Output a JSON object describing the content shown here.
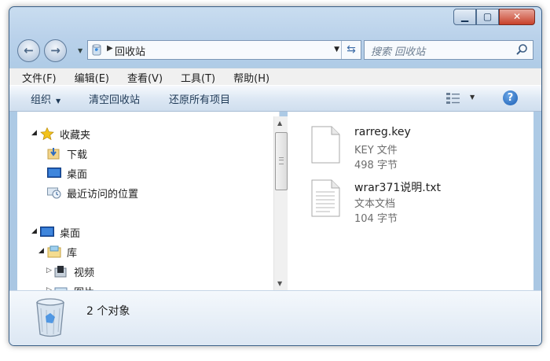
{
  "window": {
    "minimize_glyph": "▁",
    "maximize_glyph": "▢",
    "close_glyph": "✕"
  },
  "nav_buttons": {
    "back_glyph": "←",
    "forward_glyph": "→"
  },
  "address": {
    "path": "回收站",
    "icon": "recycle-bin-icon"
  },
  "search": {
    "placeholder": "搜索 回收站"
  },
  "menu": [
    "文件(F)",
    "编辑(E)",
    "查看(V)",
    "工具(T)",
    "帮助(H)"
  ],
  "toolbar": {
    "organize": "组织",
    "empty_bin": "清空回收站",
    "restore_all": "还原所有项目",
    "help_glyph": "?"
  },
  "nav_tree": {
    "favorites": {
      "label": "收藏夹",
      "items": [
        "下载",
        "桌面",
        "最近访问的位置"
      ]
    },
    "desktop": {
      "label": "桌面"
    },
    "library": {
      "label": "库",
      "items": [
        "视频",
        "图片"
      ]
    }
  },
  "files": [
    {
      "name": "rarreg.key",
      "type": "KEY 文件",
      "size": "498 字节"
    },
    {
      "name": "wrar371说明.txt",
      "type": "文本文档",
      "size": "104 字节"
    }
  ],
  "details": {
    "count": "2 个对象"
  }
}
